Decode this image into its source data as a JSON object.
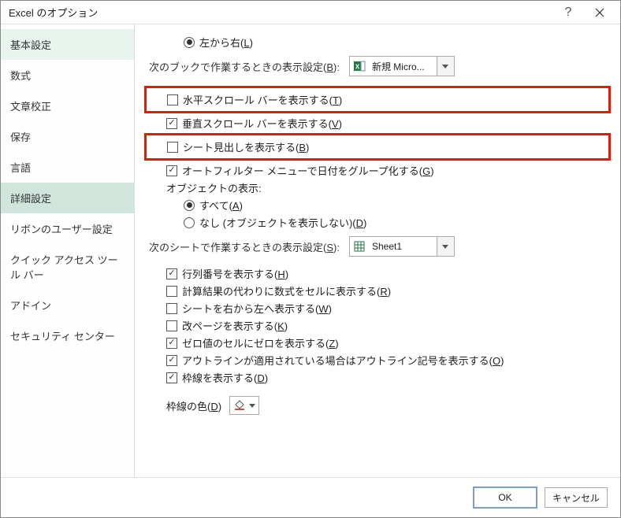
{
  "title": "Excel のオプション",
  "sidebar": {
    "items": [
      {
        "label": "基本設定"
      },
      {
        "label": "数式"
      },
      {
        "label": "文章校正"
      },
      {
        "label": "保存"
      },
      {
        "label": "言語"
      },
      {
        "label": "詳細設定"
      },
      {
        "label": "リボンのユーザー設定"
      },
      {
        "label": "クイック アクセス ツール バー"
      },
      {
        "label": "アドイン"
      },
      {
        "label": "セキュリティ センター"
      }
    ],
    "selected_index": 5
  },
  "content": {
    "left_to_right": {
      "label_parts": [
        "左から右(",
        "L",
        ")"
      ]
    },
    "section_workbook": {
      "heading_parts": [
        "次のブックで作業するときの表示設定(",
        "B",
        "):"
      ],
      "combo_value": "新規 Micro...",
      "items": {
        "hscroll": {
          "parts": [
            "水平スクロール バーを表示する(",
            "T",
            ")"
          ],
          "checked": false
        },
        "vscroll": {
          "parts": [
            "垂直スクロール バーを表示する(",
            "V",
            ")"
          ],
          "checked": true
        },
        "sheet_tabs": {
          "parts": [
            "シート見出しを表示する(",
            "B",
            ")"
          ],
          "checked": false
        },
        "autofilter": {
          "parts": [
            "オートフィルター メニューで日付をグループ化する(",
            "G",
            ")"
          ],
          "checked": true
        },
        "objects_label": "オブジェクトの表示:",
        "obj_all": {
          "parts": [
            "すべて(",
            "A",
            ")"
          ]
        },
        "obj_none": {
          "parts": [
            "なし (オブジェクトを表示しない)(",
            "D",
            ")"
          ]
        }
      }
    },
    "section_sheet": {
      "heading_parts": [
        "次のシートで作業するときの表示設定(",
        "S",
        "):"
      ],
      "combo_value": "Sheet1",
      "items": {
        "rowcol": {
          "parts": [
            "行列番号を表示する(",
            "H",
            ")"
          ],
          "checked": true
        },
        "formulas": {
          "parts": [
            "計算結果の代わりに数式をセルに表示する(",
            "R",
            ")"
          ],
          "checked": false
        },
        "rtl": {
          "parts": [
            "シートを右から左へ表示する(",
            "W",
            ")"
          ],
          "checked": false
        },
        "pagebreaks": {
          "parts": [
            "改ページを表示する(",
            "K",
            ")"
          ],
          "checked": false
        },
        "zeros": {
          "parts": [
            "ゼロ値のセルにゼロを表示する(",
            "Z",
            ")"
          ],
          "checked": true
        },
        "outline": {
          "parts": [
            "アウトラインが適用されている場合はアウトライン記号を表示する(",
            "O",
            ")"
          ],
          "checked": true
        },
        "gridlines": {
          "parts": [
            "枠線を表示する(",
            "D",
            ")"
          ],
          "checked": true
        }
      },
      "grid_color_label_parts": [
        "枠線の色(",
        "D",
        ")"
      ]
    }
  },
  "buttons": {
    "ok": "OK",
    "cancel": "キャンセル"
  }
}
